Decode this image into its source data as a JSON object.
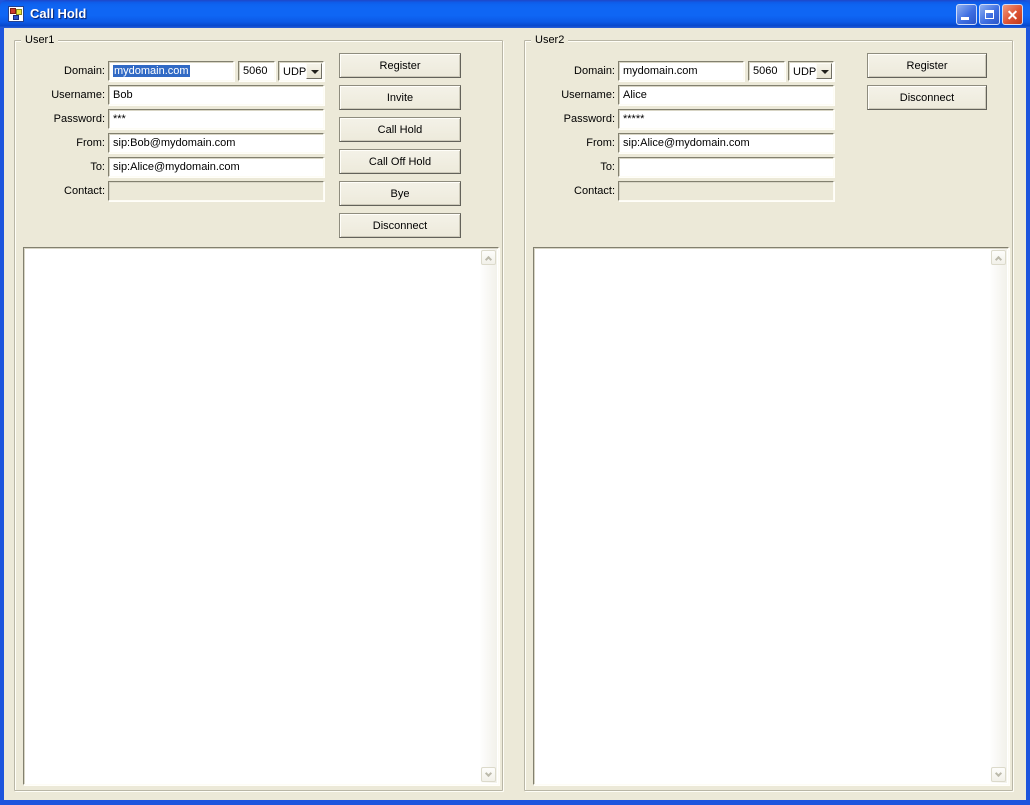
{
  "window": {
    "title": "Call Hold",
    "controls": {
      "minimize_icon": "minimize",
      "maximize_icon": "maximize",
      "close_icon": "close"
    }
  },
  "colors": {
    "titlebar_blue": "#0f63f2",
    "form_background": "#ece9d8",
    "selection_blue": "#316ac5",
    "close_red": "#d6492a"
  },
  "user1": {
    "group_label": "User1",
    "fields": {
      "domain": {
        "label": "Domain:",
        "value": "mydomain.com",
        "selected": true,
        "port": "5060",
        "transport": "UDP"
      },
      "username": {
        "label": "Username:",
        "value": "Bob"
      },
      "password": {
        "label": "Password:",
        "value": "***"
      },
      "from": {
        "label": "From:",
        "value": "sip:Bob@mydomain.com"
      },
      "to": {
        "label": "To:",
        "value": "sip:Alice@mydomain.com"
      },
      "contact": {
        "label": "Contact:",
        "value": "",
        "disabled": true
      }
    },
    "buttons": [
      "Register",
      "Invite",
      "Call Hold",
      "Call Off Hold",
      "Bye",
      "Disconnect"
    ],
    "log": ""
  },
  "user2": {
    "group_label": "User2",
    "fields": {
      "domain": {
        "label": "Domain:",
        "value": "mydomain.com",
        "selected": false,
        "port": "5060",
        "transport": "UDP"
      },
      "username": {
        "label": "Username:",
        "value": "Alice"
      },
      "password": {
        "label": "Password:",
        "value": "*****"
      },
      "from": {
        "label": "From:",
        "value": "sip:Alice@mydomain.com"
      },
      "to": {
        "label": "To:",
        "value": ""
      },
      "contact": {
        "label": "Contact:",
        "value": "",
        "disabled": true
      }
    },
    "buttons": [
      "Register",
      "Disconnect"
    ],
    "log": ""
  }
}
